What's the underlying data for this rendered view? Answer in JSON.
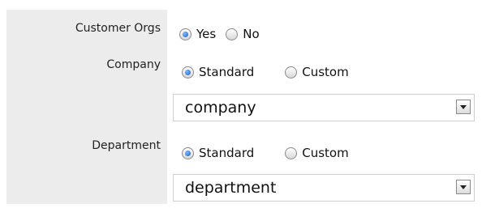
{
  "fields": {
    "customer_orgs": {
      "label": "Customer Orgs",
      "options": [
        {
          "label": "Yes",
          "selected": true
        },
        {
          "label": "No",
          "selected": false
        }
      ]
    },
    "company": {
      "label": "Company",
      "options": [
        {
          "label": "Standard",
          "selected": true
        },
        {
          "label": "Custom",
          "selected": false
        }
      ],
      "select_value": "company"
    },
    "department": {
      "label": "Department",
      "options": [
        {
          "label": "Standard",
          "selected": true
        },
        {
          "label": "Custom",
          "selected": false
        }
      ],
      "select_value": "department"
    }
  },
  "icons": {
    "dropdown": "chevron-down-icon",
    "radio_on": "radio-selected-icon",
    "radio_off": "radio-unselected-icon"
  },
  "colors": {
    "label_background": "#ececec",
    "radio_accent": "#1b5fc4"
  }
}
